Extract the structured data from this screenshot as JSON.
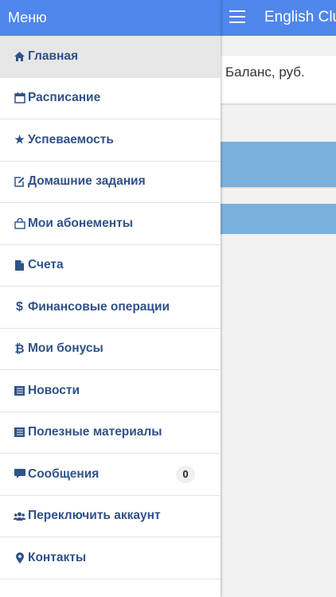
{
  "drawer": {
    "title": "Меню",
    "items": [
      {
        "label": "Главная",
        "icon": "home-icon",
        "active": true
      },
      {
        "label": "Расписание",
        "icon": "calendar-icon"
      },
      {
        "label": "Успеваемость",
        "icon": "star-icon"
      },
      {
        "label": "Домашние задания",
        "icon": "edit-icon"
      },
      {
        "label": "Мои абонементы",
        "icon": "bag-icon"
      },
      {
        "label": "Счета",
        "icon": "document-icon"
      },
      {
        "label": "Финансовые операции",
        "icon": "dollar-icon"
      },
      {
        "label": "Мои бонусы",
        "icon": "bitcoin-icon"
      },
      {
        "label": "Новости",
        "icon": "list-icon"
      },
      {
        "label": "Полезные материалы",
        "icon": "list-icon"
      },
      {
        "label": "Сообщения",
        "icon": "message-icon",
        "badge": "0"
      },
      {
        "label": "Переключить аккаунт",
        "icon": "users-icon"
      },
      {
        "label": "Контакты",
        "icon": "location-pin-icon"
      }
    ]
  },
  "appbar": {
    "title": "English Clu"
  },
  "main": {
    "balance_title": "Баланс, руб."
  },
  "colors": {
    "primary": "#4f86ec",
    "menu_text": "#2f5288",
    "band": "#7ab1dc"
  }
}
